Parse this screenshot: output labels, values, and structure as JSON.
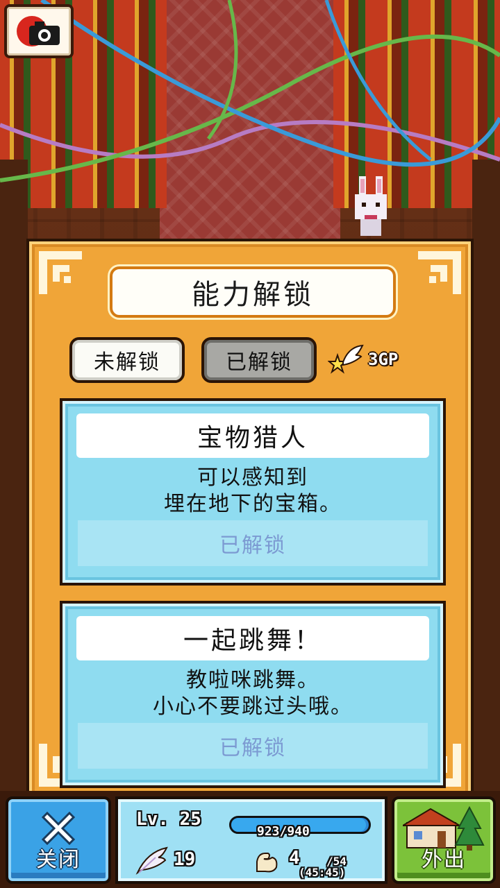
{
  "header": {
    "title": "能力解锁"
  },
  "tabs": {
    "locked_label": "未解锁",
    "unlocked_label": "已解锁"
  },
  "gp": {
    "amount": "3GP"
  },
  "abilities": [
    {
      "name": "宝物猎人",
      "desc_line1": "可以感知到",
      "desc_line2": "埋在地下的宝箱。",
      "status": "已解锁"
    },
    {
      "name": "一起跳舞！",
      "desc_line1": "教啦咪跳舞。",
      "desc_line2": "小心不要跳过头哦。",
      "status": "已解锁"
    }
  ],
  "bottom": {
    "close_label": "关闭",
    "go_out_label": "外出",
    "level": "Lv. 25",
    "exp_text": "923/940",
    "exp_fraction": 0.982,
    "feathers": "19",
    "stamina": "4",
    "stamina_max": "/54",
    "stamina_sub": "(45:45)"
  },
  "colors": {
    "panel": "#f0a538",
    "card": "#8fdcf0",
    "close_button": "#3aa2e6",
    "go_button": "#7cc23a"
  },
  "icons": [
    "camera-icon",
    "winged-star-icon",
    "close-x-icon",
    "house-tree-icon",
    "feather-icon",
    "muscle-arm-icon",
    "rabbit-character"
  ]
}
